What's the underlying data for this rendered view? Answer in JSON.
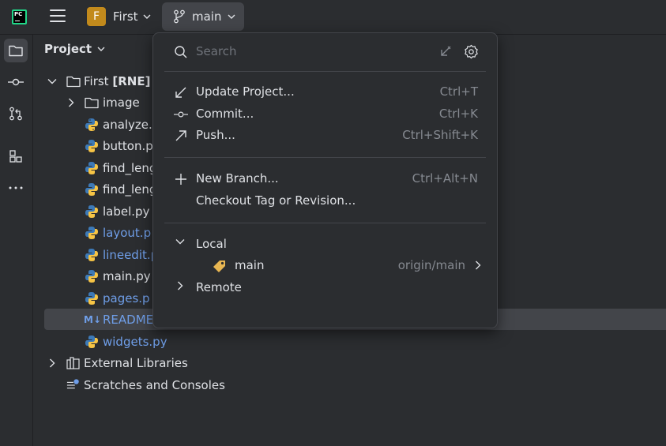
{
  "titlebar": {
    "app_logo_text": "PC",
    "project": {
      "badge": "F",
      "name": "First"
    },
    "branch": {
      "name": "main"
    }
  },
  "sidebar_tools": [
    "project-icon",
    "commit-icon",
    "pull-requests-icon",
    "structure-icon",
    "more-icon"
  ],
  "project_panel": {
    "title": "Project",
    "tree": [
      {
        "label": "First",
        "suffix": "[RNE]",
        "type": "folder",
        "expanded": true
      },
      {
        "label": "image",
        "type": "folder",
        "expanded": false
      },
      {
        "label": "analyze.",
        "type": "python",
        "color": "default"
      },
      {
        "label": "button.p",
        "type": "python",
        "color": "default"
      },
      {
        "label": "find_leng",
        "type": "python",
        "color": "default"
      },
      {
        "label": "find_leng",
        "type": "python",
        "color": "default"
      },
      {
        "label": "label.py",
        "type": "python",
        "color": "default"
      },
      {
        "label": "layout.p",
        "type": "python",
        "color": "blue"
      },
      {
        "label": "lineedit.p",
        "type": "python",
        "color": "blue"
      },
      {
        "label": "main.py",
        "type": "python",
        "color": "default"
      },
      {
        "label": "pages.p",
        "type": "python",
        "color": "blue"
      },
      {
        "label": "README",
        "type": "markdown",
        "color": "blue",
        "icon_text": "M↓"
      },
      {
        "label": "widgets.py",
        "type": "python",
        "color": "blue"
      },
      {
        "label": "External Libraries",
        "type": "library"
      },
      {
        "label": "Scratches and Consoles",
        "type": "scratches"
      }
    ]
  },
  "popup": {
    "search_placeholder": "Search",
    "actions": [
      {
        "label": "Update Project...",
        "shortcut": "Ctrl+T",
        "icon": "update-arrow-icon"
      },
      {
        "label": "Commit...",
        "shortcut": "Ctrl+K",
        "icon": "commit-icon"
      },
      {
        "label": "Push...",
        "shortcut": "Ctrl+Shift+K",
        "icon": "push-arrow-icon"
      }
    ],
    "branch_actions": [
      {
        "label": "New Branch...",
        "shortcut": "Ctrl+Alt+N",
        "icon": "plus-icon"
      },
      {
        "label": "Checkout Tag or Revision...",
        "shortcut": "",
        "icon": ""
      }
    ],
    "local_group": "Local",
    "local_branch": {
      "name": "main",
      "tracking": "origin/main"
    },
    "remote_group": "Remote"
  },
  "colors": {
    "background": "#1e1f22",
    "panel": "#2b2d30",
    "accent_blue": "#6f9ee8",
    "project_badge": "#c28a1c",
    "tag_yellow": "#e8b652"
  }
}
